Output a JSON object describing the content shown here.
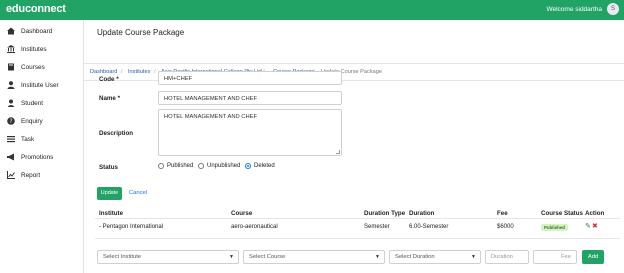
{
  "app": {
    "brand": "educonnect",
    "welcome": "Welcome siddartha",
    "avatar_initial": "S"
  },
  "colors": {
    "accent": "#21a366",
    "link": "#2563a8",
    "published_bg": "#d8f0c5"
  },
  "sidebar": {
    "items": [
      {
        "label": "Dashboard",
        "icon": "home-icon"
      },
      {
        "label": "Institutes",
        "icon": "institution-icon"
      },
      {
        "label": "Courses",
        "icon": "book-icon"
      },
      {
        "label": "Institute User",
        "icon": "user-icon"
      },
      {
        "label": "Student",
        "icon": "student-icon"
      },
      {
        "label": "Enquiry",
        "icon": "question-icon"
      },
      {
        "label": "Task",
        "icon": "list-icon"
      },
      {
        "label": "Promotions",
        "icon": "megaphone-icon"
      },
      {
        "label": "Report",
        "icon": "chart-icon"
      }
    ]
  },
  "page": {
    "title": "Update Course Package"
  },
  "breadcrumb": [
    "Dashboard",
    "Institutes",
    "Asia Pacific International College Pty Ltd",
    "Course Package",
    "Update Course Package"
  ],
  "form": {
    "code_label": "Code *",
    "code_value": "HM+CHEF",
    "name_label": "Name *",
    "name_value": "HOTEL MANAGEMENT AND CHEF",
    "description_label": "Description",
    "description_value": "HOTEL MANAGEMENT AND CHEF",
    "status_label": "Status",
    "status_options": [
      "Published",
      "Unpublished",
      "Deleted"
    ],
    "status_selected": "Deleted",
    "update_label": "Update",
    "cancel_label": "Cancel"
  },
  "table": {
    "headers": [
      "Institute",
      "Course",
      "Duration Type",
      "Duration",
      "Fee",
      "Course Status",
      "Action"
    ],
    "rows": [
      {
        "institute": "- Pentagon International",
        "course": "aero-aeronautical",
        "duration_type": "Semester",
        "duration": "6.00-Semester",
        "fee": "$6000",
        "status": "Published",
        "actions": [
          "edit-icon",
          "delete-icon"
        ]
      }
    ]
  },
  "add_row": {
    "institute_placeholder": "Select Institute",
    "course_placeholder": "Select Course",
    "duration_placeholder": "Select Duration",
    "duration_input_placeholder": "Duration",
    "fee_placeholder": "Fee",
    "add_label": "Add"
  }
}
